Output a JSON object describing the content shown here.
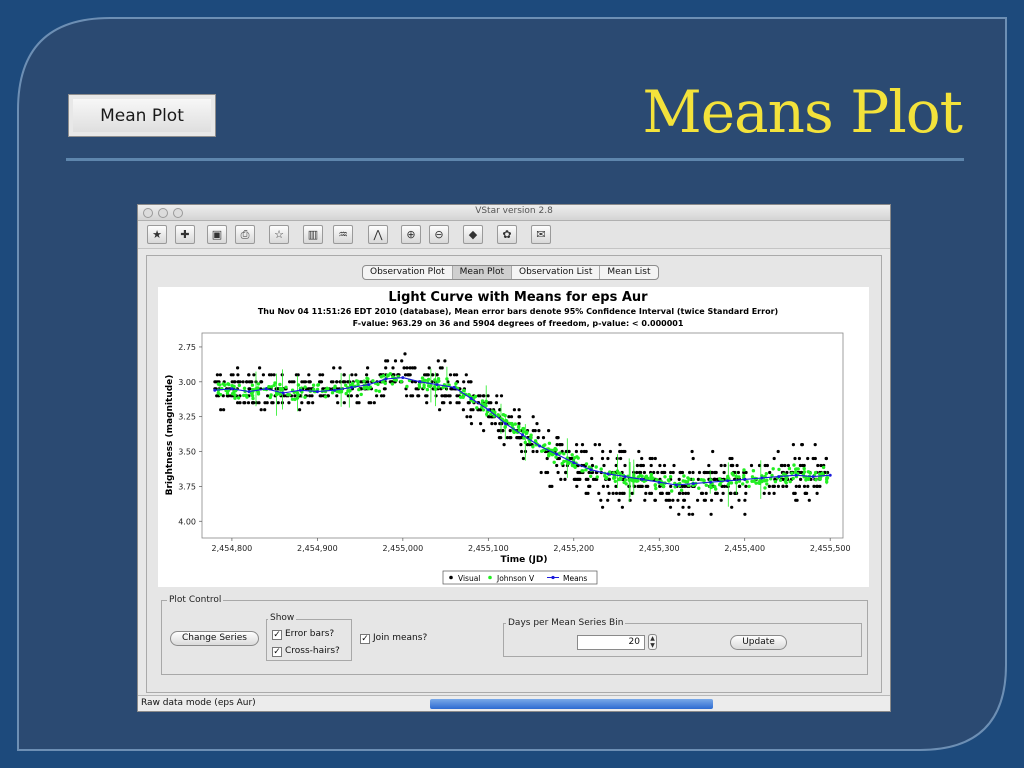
{
  "slide": {
    "title": "Means Plot",
    "thumb_label": "Mean Plot"
  },
  "window": {
    "title": "VStar version 2.8",
    "toolbar_icons": [
      "new-star-icon",
      "open-file-icon",
      "save-icon",
      "print-icon",
      "star-info-icon",
      "plot-icon",
      "phase-icon",
      "model-icon",
      "zoom-in-icon",
      "zoom-out-icon",
      "filter-icon",
      "plugin-icon",
      "help-icon"
    ]
  },
  "tabs": [
    {
      "label": "Observation Plot",
      "active": false
    },
    {
      "label": "Mean Plot",
      "active": true
    },
    {
      "label": "Observation List",
      "active": false
    },
    {
      "label": "Mean List",
      "active": false
    }
  ],
  "chart_data": {
    "type": "scatter",
    "title": "Light Curve with Means for eps Aur",
    "subtitle": "Thu Nov 04 11:51:26 EDT 2010 (database), Mean error bars denote 95% Confidence Interval (twice Standard Error)",
    "subtitle2": "F-value: 963.29 on 36 and 5904 degrees of freedom, p-value: < 0.000001",
    "xlabel": "Time (JD)",
    "ylabel": "Brightness (magnitude)",
    "xlim": [
      2454765,
      2455515
    ],
    "ylim": [
      2.65,
      4.12
    ],
    "y_inverted": true,
    "x_ticks": [
      2454800,
      2454900,
      2455000,
      2455100,
      2455200,
      2455300,
      2455400,
      2455500
    ],
    "x_tick_labels": [
      "2,454,800",
      "2,454,900",
      "2,455,000",
      "2,455,100",
      "2,455,200",
      "2,455,300",
      "2,455,400",
      "2,455,500"
    ],
    "y_ticks": [
      2.75,
      3.0,
      3.25,
      3.5,
      3.75,
      4.0
    ],
    "y_tick_labels": [
      "2.75",
      "3.00",
      "3.25",
      "3.50",
      "3.75",
      "4.00"
    ],
    "grid": false,
    "legend_placement": "bottom-center",
    "series": [
      {
        "name": "Visual",
        "color": "#000000",
        "marker": "dot"
      },
      {
        "name": "Johnson V",
        "color": "#22ee22",
        "marker": "dot"
      },
      {
        "name": "Means",
        "color": "#1a1adc",
        "marker": "line-dot",
        "x": [
          2454780,
          2454800,
          2454820,
          2454840,
          2454860,
          2454880,
          2454900,
          2454920,
          2454940,
          2454960,
          2454980,
          2455000,
          2455020,
          2455040,
          2455060,
          2455080,
          2455100,
          2455120,
          2455140,
          2455160,
          2455180,
          2455200,
          2455220,
          2455240,
          2455260,
          2455280,
          2455300,
          2455320,
          2455340,
          2455360,
          2455380,
          2455400,
          2455420,
          2455440,
          2455460,
          2455480,
          2455500
        ],
        "y": [
          3.06,
          3.05,
          3.07,
          3.05,
          3.08,
          3.06,
          3.07,
          3.06,
          3.04,
          3.02,
          2.98,
          2.97,
          3.0,
          3.02,
          3.04,
          3.12,
          3.2,
          3.3,
          3.38,
          3.46,
          3.52,
          3.58,
          3.63,
          3.66,
          3.68,
          3.7,
          3.72,
          3.74,
          3.73,
          3.72,
          3.71,
          3.7,
          3.69,
          3.68,
          3.67,
          3.68,
          3.67
        ]
      }
    ]
  },
  "plot_control": {
    "title": "Plot Control",
    "change_series": "Change Series",
    "show_label": "Show",
    "error_bars": "Error bars?",
    "cross_hairs": "Cross-hairs?",
    "join_means": "Join means?",
    "bin_group_label": "Days per Mean Series Bin",
    "bin_value": "20",
    "update": "Update",
    "check_mark": "✓"
  },
  "status": {
    "text": "Raw data mode (eps Aur)",
    "progress": 1.0
  }
}
